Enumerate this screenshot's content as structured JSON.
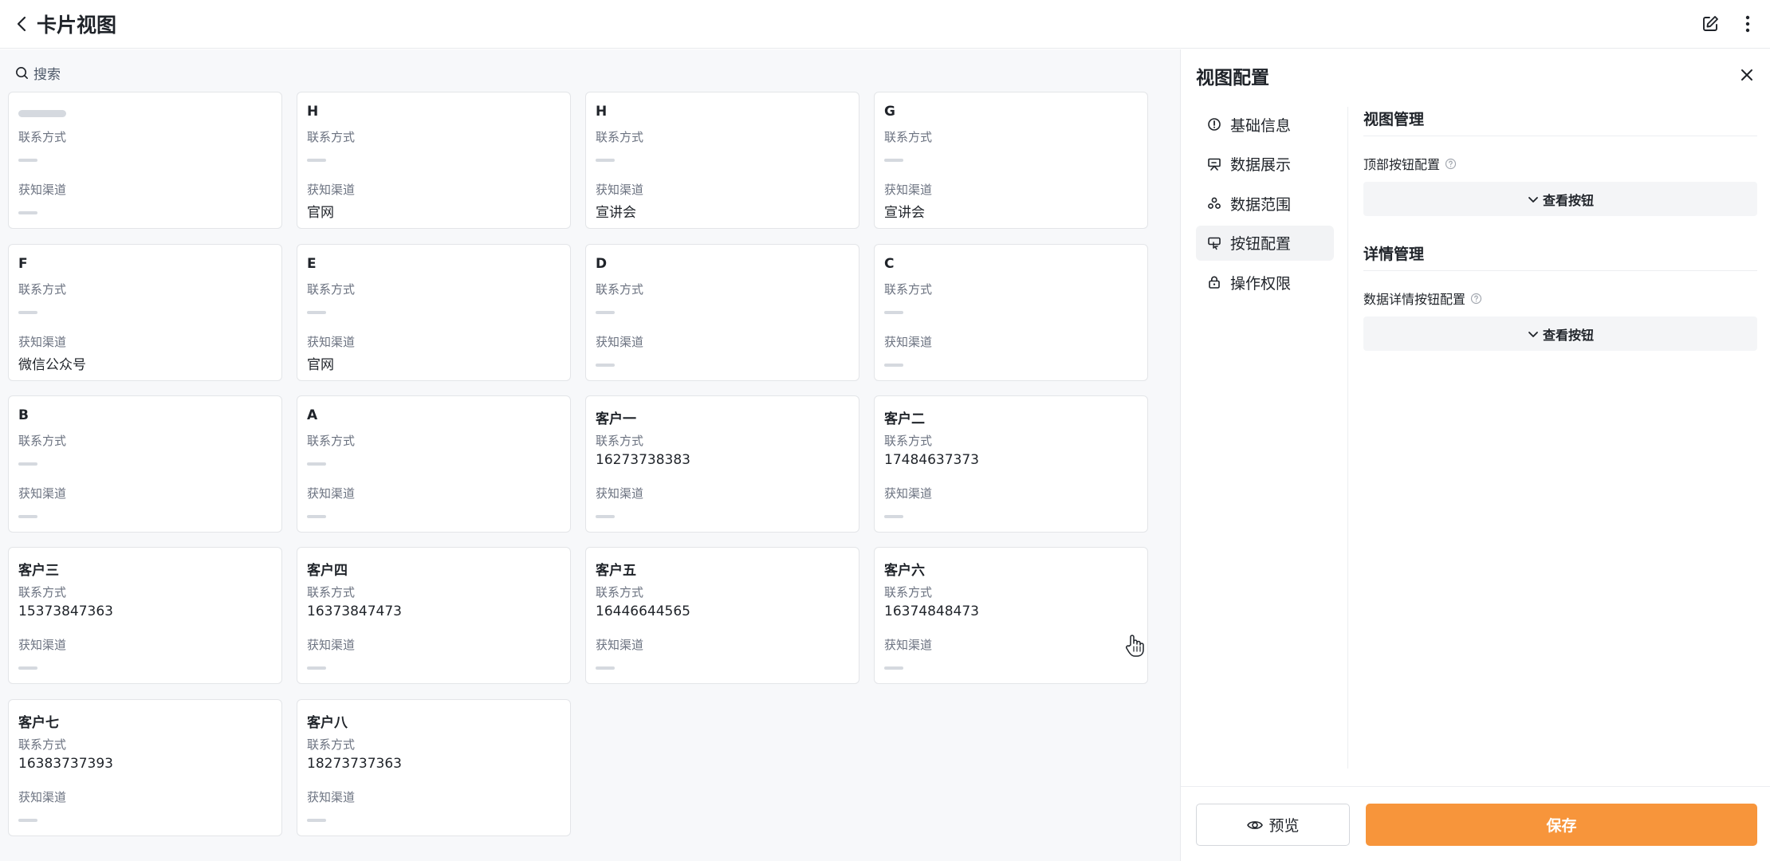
{
  "header": {
    "title": "卡片视图",
    "back_icon": "chevron-left-icon",
    "edit_icon": "edit-icon",
    "more_icon": "more-vertical-icon"
  },
  "search": {
    "placeholder": "搜索"
  },
  "card_labels": {
    "contact": "联系方式",
    "channel": "获知渠道"
  },
  "cards": [
    {
      "title": "",
      "contact": "",
      "channel": ""
    },
    {
      "title": "H",
      "contact": "",
      "channel": "官网"
    },
    {
      "title": "H",
      "contact": "",
      "channel": "宣讲会"
    },
    {
      "title": "G",
      "contact": "",
      "channel": "宣讲会"
    },
    {
      "title": "F",
      "contact": "",
      "channel": "微信公众号"
    },
    {
      "title": "E",
      "contact": "",
      "channel": "官网"
    },
    {
      "title": "D",
      "contact": "",
      "channel": ""
    },
    {
      "title": "C",
      "contact": "",
      "channel": ""
    },
    {
      "title": "B",
      "contact": "",
      "channel": ""
    },
    {
      "title": "A",
      "contact": "",
      "channel": ""
    },
    {
      "title": "客户一",
      "contact": "16273738383",
      "channel": ""
    },
    {
      "title": "客户二",
      "contact": "17484637373",
      "channel": ""
    },
    {
      "title": "客户三",
      "contact": "15373847363",
      "channel": ""
    },
    {
      "title": "客户四",
      "contact": "16373847473",
      "channel": ""
    },
    {
      "title": "客户五",
      "contact": "16446644565",
      "channel": ""
    },
    {
      "title": "客户六",
      "contact": "16374848473",
      "channel": ""
    },
    {
      "title": "客户七",
      "contact": "16383737393",
      "channel": ""
    },
    {
      "title": "客户八",
      "contact": "18273737363",
      "channel": ""
    }
  ],
  "panel": {
    "title": "视图配置",
    "nav": [
      {
        "label": "基础信息",
        "icon": "info-icon"
      },
      {
        "label": "数据展示",
        "icon": "presentation-icon"
      },
      {
        "label": "数据范围",
        "icon": "scope-icon"
      },
      {
        "label": "按钮配置",
        "icon": "button-config-icon",
        "active": true
      },
      {
        "label": "操作权限",
        "icon": "lock-icon"
      }
    ],
    "view_mgmt": {
      "title": "视图管理",
      "top_button_label": "顶部按钮配置",
      "expand_label": "查看按钮"
    },
    "detail_mgmt": {
      "title": "详情管理",
      "detail_button_label": "数据详情按钮配置",
      "expand_label": "查看按钮"
    },
    "footer": {
      "preview": "预览",
      "save": "保存"
    }
  },
  "colors": {
    "accent": "#f7953b",
    "background": "#f7f8fa",
    "card_border": "#e3e5e8"
  }
}
